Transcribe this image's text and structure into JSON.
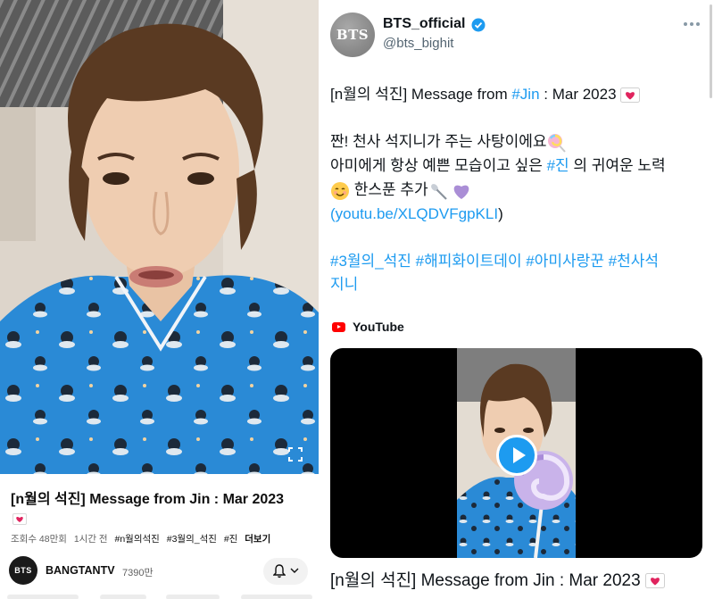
{
  "youtube": {
    "video_title": "[n월의 석진] Message from Jin : Mar 2023",
    "title_emoji": "love-letter-icon",
    "meta": {
      "views": "조회수 48만회",
      "time": "1시간 전",
      "tags": [
        "#n월의석진",
        "#3월의_석진",
        "#진"
      ],
      "more_label": "더보기"
    },
    "channel": {
      "avatar_text": "BTS",
      "name": "BANGTANTV",
      "subscribers": "7390만"
    },
    "icons": [
      "fullscreen-icon",
      "bell-icon",
      "chevron-down-icon"
    ]
  },
  "twitter": {
    "account": {
      "avatar_text": "BTS",
      "name": "BTS_official",
      "handle": "@bts_bighit",
      "verified": true
    },
    "tweet": {
      "line1_prefix": "[n월의 석진] Message from ",
      "line1_hashtag": "#Jin",
      "line1_suffix": " : Mar 2023 ",
      "line2": "짠! 천사 석지니가 주는 사탕이에요",
      "line3_prefix": "아미에게 항상 예쁜 모습이고 싶은 ",
      "line3_hashtag": "#진",
      "line3_suffix": " 의 귀여운 노력",
      "line4": " 한스푼 추가",
      "link_open": "(",
      "link": "youtu.be/XLQDVFgpKLI",
      "link_close": ")",
      "hashtags_line1": "#3월의_석진 #해피화이트데이 #아미사랑꾼 #천사석",
      "hashtags_line2": "지니"
    },
    "emojis": [
      "love-letter-icon",
      "lollipop-icon",
      "smiling-face-icon",
      "spoon-icon",
      "purple-heart-icon"
    ],
    "card": {
      "source_label": "YouTube",
      "title": "[n월의 석진] Message from Jin : Mar 2023"
    }
  },
  "colors": {
    "twitter_link": "#1d9bf0",
    "youtube_red": "#ff0000",
    "pajama_blue": "#2e8fd8"
  }
}
